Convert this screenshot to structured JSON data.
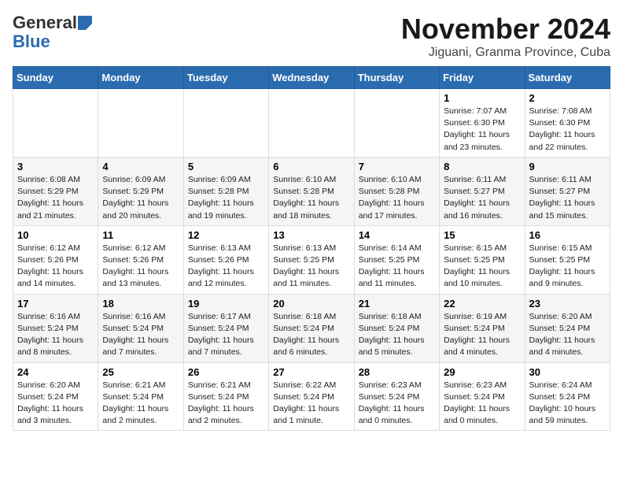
{
  "logo": {
    "general": "General",
    "blue": "Blue"
  },
  "title": "November 2024",
  "location": "Jiguani, Granma Province, Cuba",
  "weekdays": [
    "Sunday",
    "Monday",
    "Tuesday",
    "Wednesday",
    "Thursday",
    "Friday",
    "Saturday"
  ],
  "weeks": [
    [
      {
        "day": "",
        "info": ""
      },
      {
        "day": "",
        "info": ""
      },
      {
        "day": "",
        "info": ""
      },
      {
        "day": "",
        "info": ""
      },
      {
        "day": "",
        "info": ""
      },
      {
        "day": "1",
        "info": "Sunrise: 7:07 AM\nSunset: 6:30 PM\nDaylight: 11 hours and 23 minutes."
      },
      {
        "day": "2",
        "info": "Sunrise: 7:08 AM\nSunset: 6:30 PM\nDaylight: 11 hours and 22 minutes."
      }
    ],
    [
      {
        "day": "3",
        "info": "Sunrise: 6:08 AM\nSunset: 5:29 PM\nDaylight: 11 hours and 21 minutes."
      },
      {
        "day": "4",
        "info": "Sunrise: 6:09 AM\nSunset: 5:29 PM\nDaylight: 11 hours and 20 minutes."
      },
      {
        "day": "5",
        "info": "Sunrise: 6:09 AM\nSunset: 5:28 PM\nDaylight: 11 hours and 19 minutes."
      },
      {
        "day": "6",
        "info": "Sunrise: 6:10 AM\nSunset: 5:28 PM\nDaylight: 11 hours and 18 minutes."
      },
      {
        "day": "7",
        "info": "Sunrise: 6:10 AM\nSunset: 5:28 PM\nDaylight: 11 hours and 17 minutes."
      },
      {
        "day": "8",
        "info": "Sunrise: 6:11 AM\nSunset: 5:27 PM\nDaylight: 11 hours and 16 minutes."
      },
      {
        "day": "9",
        "info": "Sunrise: 6:11 AM\nSunset: 5:27 PM\nDaylight: 11 hours and 15 minutes."
      }
    ],
    [
      {
        "day": "10",
        "info": "Sunrise: 6:12 AM\nSunset: 5:26 PM\nDaylight: 11 hours and 14 minutes."
      },
      {
        "day": "11",
        "info": "Sunrise: 6:12 AM\nSunset: 5:26 PM\nDaylight: 11 hours and 13 minutes."
      },
      {
        "day": "12",
        "info": "Sunrise: 6:13 AM\nSunset: 5:26 PM\nDaylight: 11 hours and 12 minutes."
      },
      {
        "day": "13",
        "info": "Sunrise: 6:13 AM\nSunset: 5:25 PM\nDaylight: 11 hours and 11 minutes."
      },
      {
        "day": "14",
        "info": "Sunrise: 6:14 AM\nSunset: 5:25 PM\nDaylight: 11 hours and 11 minutes."
      },
      {
        "day": "15",
        "info": "Sunrise: 6:15 AM\nSunset: 5:25 PM\nDaylight: 11 hours and 10 minutes."
      },
      {
        "day": "16",
        "info": "Sunrise: 6:15 AM\nSunset: 5:25 PM\nDaylight: 11 hours and 9 minutes."
      }
    ],
    [
      {
        "day": "17",
        "info": "Sunrise: 6:16 AM\nSunset: 5:24 PM\nDaylight: 11 hours and 8 minutes."
      },
      {
        "day": "18",
        "info": "Sunrise: 6:16 AM\nSunset: 5:24 PM\nDaylight: 11 hours and 7 minutes."
      },
      {
        "day": "19",
        "info": "Sunrise: 6:17 AM\nSunset: 5:24 PM\nDaylight: 11 hours and 7 minutes."
      },
      {
        "day": "20",
        "info": "Sunrise: 6:18 AM\nSunset: 5:24 PM\nDaylight: 11 hours and 6 minutes."
      },
      {
        "day": "21",
        "info": "Sunrise: 6:18 AM\nSunset: 5:24 PM\nDaylight: 11 hours and 5 minutes."
      },
      {
        "day": "22",
        "info": "Sunrise: 6:19 AM\nSunset: 5:24 PM\nDaylight: 11 hours and 4 minutes."
      },
      {
        "day": "23",
        "info": "Sunrise: 6:20 AM\nSunset: 5:24 PM\nDaylight: 11 hours and 4 minutes."
      }
    ],
    [
      {
        "day": "24",
        "info": "Sunrise: 6:20 AM\nSunset: 5:24 PM\nDaylight: 11 hours and 3 minutes."
      },
      {
        "day": "25",
        "info": "Sunrise: 6:21 AM\nSunset: 5:24 PM\nDaylight: 11 hours and 2 minutes."
      },
      {
        "day": "26",
        "info": "Sunrise: 6:21 AM\nSunset: 5:24 PM\nDaylight: 11 hours and 2 minutes."
      },
      {
        "day": "27",
        "info": "Sunrise: 6:22 AM\nSunset: 5:24 PM\nDaylight: 11 hours and 1 minute."
      },
      {
        "day": "28",
        "info": "Sunrise: 6:23 AM\nSunset: 5:24 PM\nDaylight: 11 hours and 0 minutes."
      },
      {
        "day": "29",
        "info": "Sunrise: 6:23 AM\nSunset: 5:24 PM\nDaylight: 11 hours and 0 minutes."
      },
      {
        "day": "30",
        "info": "Sunrise: 6:24 AM\nSunset: 5:24 PM\nDaylight: 10 hours and 59 minutes."
      }
    ]
  ]
}
